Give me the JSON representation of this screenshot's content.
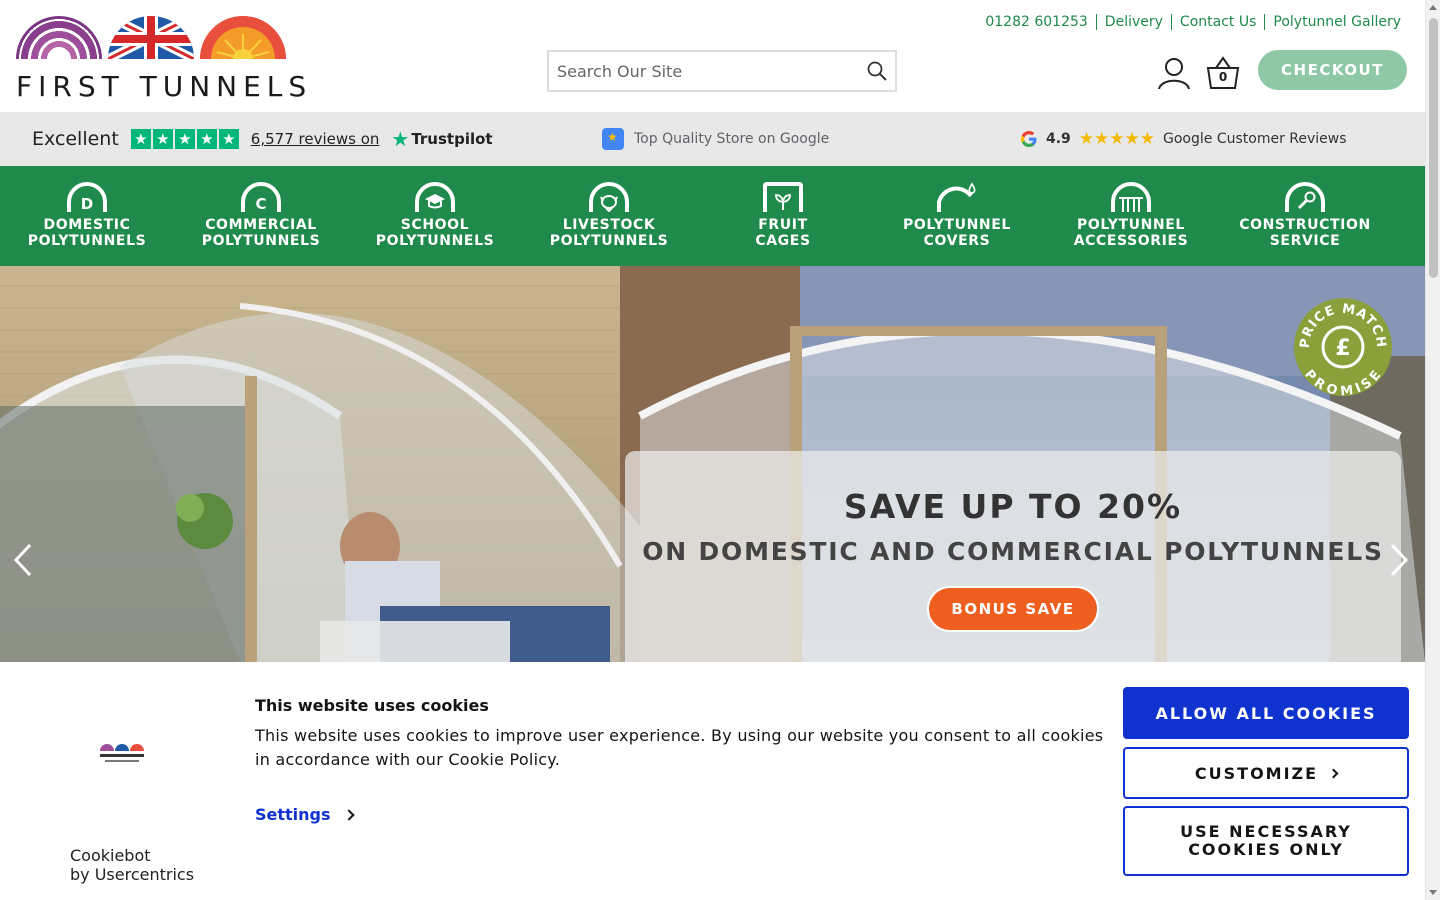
{
  "header": {
    "logo_text": "FIRST TUNNELS",
    "top_links": [
      "01282 601253",
      "Delivery",
      "Contact Us",
      "Polytunnel Gallery"
    ],
    "search_placeholder": "Search Our Site",
    "basket_count": "0",
    "checkout_label": "CHECKOUT"
  },
  "reviews": {
    "trustpilot_rating_word": "Excellent",
    "trustpilot_stars": 5,
    "trustpilot_reviews": "6,577 reviews on",
    "trustpilot_brand": "Trustpilot",
    "google_store_text": "Top Quality Store on Google",
    "google_rating": "4.9",
    "google_stars": 4.9,
    "google_reviews_text": "Google Customer Reviews"
  },
  "nav": {
    "items": [
      {
        "line1": "DOMESTIC",
        "line2": "POLYTUNNELS",
        "icon": "domestic-arch-icon"
      },
      {
        "line1": "COMMERCIAL",
        "line2": "POLYTUNNELS",
        "icon": "commercial-arch-icon"
      },
      {
        "line1": "SCHOOL",
        "line2": "POLYTUNNELS",
        "icon": "school-arch-icon"
      },
      {
        "line1": "LIVESTOCK",
        "line2": "POLYTUNNELS",
        "icon": "livestock-arch-icon"
      },
      {
        "line1": "FRUIT",
        "line2": "CAGES",
        "icon": "fruit-cage-icon"
      },
      {
        "line1": "POLYTUNNEL",
        "line2": "COVERS",
        "icon": "cover-arch-icon"
      },
      {
        "line1": "POLYTUNNEL",
        "line2": "ACCESSORIES",
        "icon": "accessories-arch-icon"
      },
      {
        "line1": "CONSTRUCTION",
        "line2": "SERVICE",
        "icon": "construction-wrench-icon"
      }
    ]
  },
  "hero": {
    "headline": "SAVE UP TO 20%",
    "subheadline": "ON DOMESTIC AND COMMERCIAL POLYTUNNELS",
    "cta_label": "BONUS SAVE",
    "badge_line1": "PRICE MATCH",
    "badge_line2": "PROMISE"
  },
  "cookie": {
    "title": "This website uses cookies",
    "text": "This website uses cookies to improve user experience. By using our website you consent to all cookies in accordance with our Cookie Policy.",
    "settings_label": "Settings",
    "allow_label": "ALLOW ALL COOKIES",
    "customize_label": "CUSTOMIZE",
    "necessary_label": "USE NECESSARY COOKIES ONLY",
    "provider_name": "Cookiebot",
    "provider_sub": "by Usercentrics"
  },
  "colors": {
    "brand_green": "#1f8a4c",
    "checkout_green": "#8fc8a6",
    "cta_orange": "#ee5f1f",
    "cookie_blue": "#1032cf",
    "trustpilot_green": "#00b67a"
  }
}
